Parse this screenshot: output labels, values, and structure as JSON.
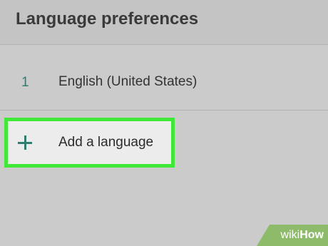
{
  "header": {
    "title": "Language preferences"
  },
  "languages": [
    {
      "index": "1",
      "name": "English (United States)"
    }
  ],
  "add_language": {
    "label": "Add a language",
    "icon": "plus-icon"
  },
  "watermark": {
    "part1": "wiki",
    "part2": "How"
  },
  "colors": {
    "accent": "#2e7d6e",
    "highlight_border": "#41e838",
    "background": "#cbcbcb"
  }
}
